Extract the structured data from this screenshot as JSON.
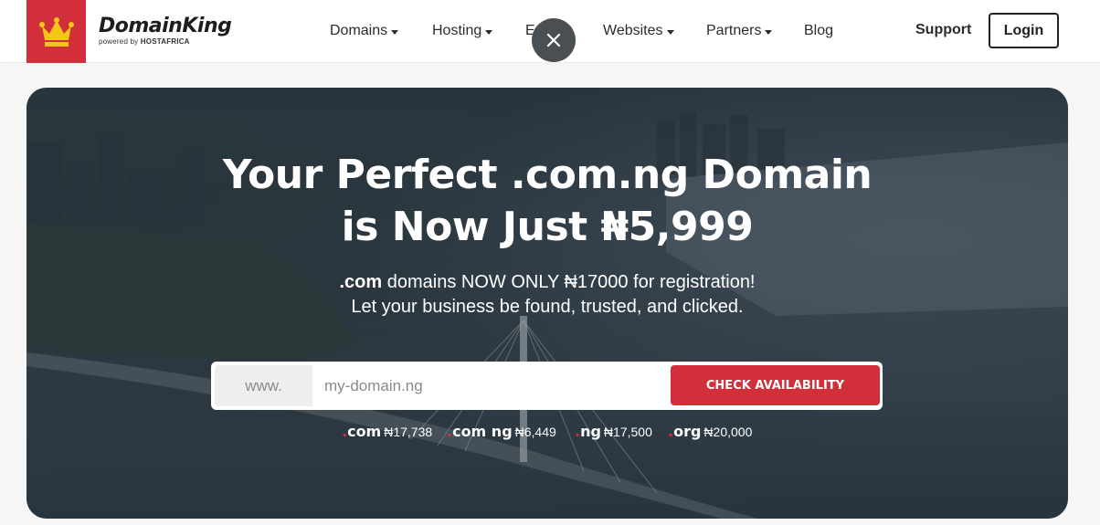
{
  "header": {
    "brand_name": "DomainKing",
    "brand_sub_prefix": "powered by ",
    "brand_sub_company": "HOSTAFRICA",
    "nav": [
      {
        "label": "Domains",
        "has_caret": true
      },
      {
        "label": "Hosting",
        "has_caret": true
      },
      {
        "label": "Email",
        "has_caret": true
      },
      {
        "label": "Websites",
        "has_caret": true
      },
      {
        "label": "Partners",
        "has_caret": true
      },
      {
        "label": "Blog",
        "has_caret": false
      }
    ],
    "support_label": "Support",
    "login_label": "Login",
    "close_icon": "close-icon"
  },
  "hero": {
    "headline_line1": "Your Perfect .com.ng Domain",
    "headline_line2": "is Now Just ₦5,999",
    "sub_line1_bold": ".com",
    "sub_line1_rest": " domains NOW ONLY ₦17000 for registration!",
    "sub_line2": "Let your business be found, trusted, and clicked.",
    "search": {
      "prefix": "www.",
      "placeholder": "my-domain.ng",
      "value": "",
      "button_label": "CHECK AVAILABILITY"
    },
    "tld_prices": [
      {
        "tld": "com",
        "price": "₦17,738"
      },
      {
        "tld": "com ng",
        "price": "₦6,449"
      },
      {
        "tld": "ng",
        "price": "₦17,500"
      },
      {
        "tld": "org",
        "price": "₦20,000"
      }
    ]
  },
  "colors": {
    "brand_red": "#d1303a",
    "text_dark": "#2b2b2b",
    "white": "#ffffff"
  }
}
